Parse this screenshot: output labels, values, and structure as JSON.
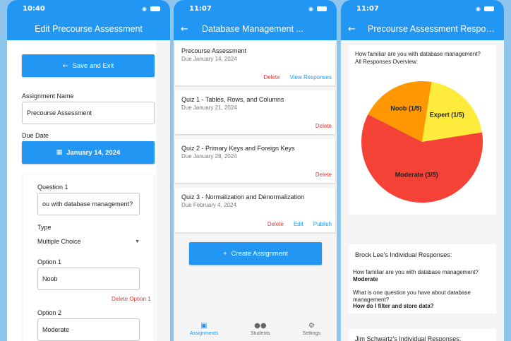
{
  "phone1": {
    "time": "10:40",
    "title": "Edit Precourse Assessment",
    "save_label": "Save and Exit",
    "assignment_name_label": "Assignment Name",
    "assignment_name_value": "Precourse Assessment",
    "due_date_label": "Due Date",
    "due_date_value": "January 14, 2024",
    "question_label": "Question 1",
    "question_value": "ou with database management?",
    "type_label": "Type",
    "type_value": "Multiple Choice",
    "option1_label": "Option 1",
    "option1_value": "Noob",
    "delete_option1": "Delete Option 1",
    "option2_label": "Option 2",
    "option2_value": "Moderate"
  },
  "phone2": {
    "time": "11:07",
    "title": "Database Management ...",
    "assignments": [
      {
        "title": "Precourse Assessment",
        "due": "Due January 14, 2024",
        "actions": [
          "Delete",
          "View Responses"
        ]
      },
      {
        "title": "Quiz 1 - Tables, Rows, and Columns",
        "due": "Due January 21, 2024",
        "actions": [
          "Delete"
        ]
      },
      {
        "title": "Quiz 2 - Primary Keys and Foreign Keys",
        "due": "Due January 28, 2024",
        "actions": [
          "Delete"
        ]
      },
      {
        "title": "Quiz 3 - Normalization and Denormalization",
        "due": "Due February 4, 2024",
        "actions": [
          "Delete",
          "Edit",
          "Publish"
        ]
      }
    ],
    "create_label": "Create Assignment",
    "nav": [
      {
        "label": "Assignments",
        "icon": "briefcase-icon",
        "active": true
      },
      {
        "label": "Students",
        "icon": "people-icon",
        "active": false
      },
      {
        "label": "Settings",
        "icon": "gear-icon",
        "active": false
      }
    ]
  },
  "phone3": {
    "time": "11:07",
    "title": "Precourse Assessment Responses",
    "question_overview": "How familiar are you with database management? All Responses Overview:",
    "pie": {
      "slices": [
        {
          "label": "Noob (1/5)",
          "value": 1,
          "color": "#ff9800"
        },
        {
          "label": "Expert (1/5)",
          "value": 1,
          "color": "#ffeb3b"
        },
        {
          "label": "Moderate (3/5)",
          "value": 3,
          "color": "#f44336"
        }
      ]
    },
    "responder1": "Brock Lee's Individual Responses:",
    "q1": "How familiar are you with database management?",
    "a1": "Moderate",
    "q2": "What is one question you have about database management?",
    "a2": "How do I filter and store data?",
    "responder2": "Jim Schwartz's Individual Responses:"
  },
  "colors": {
    "primary": "#2196f3",
    "danger": "#e53935"
  }
}
